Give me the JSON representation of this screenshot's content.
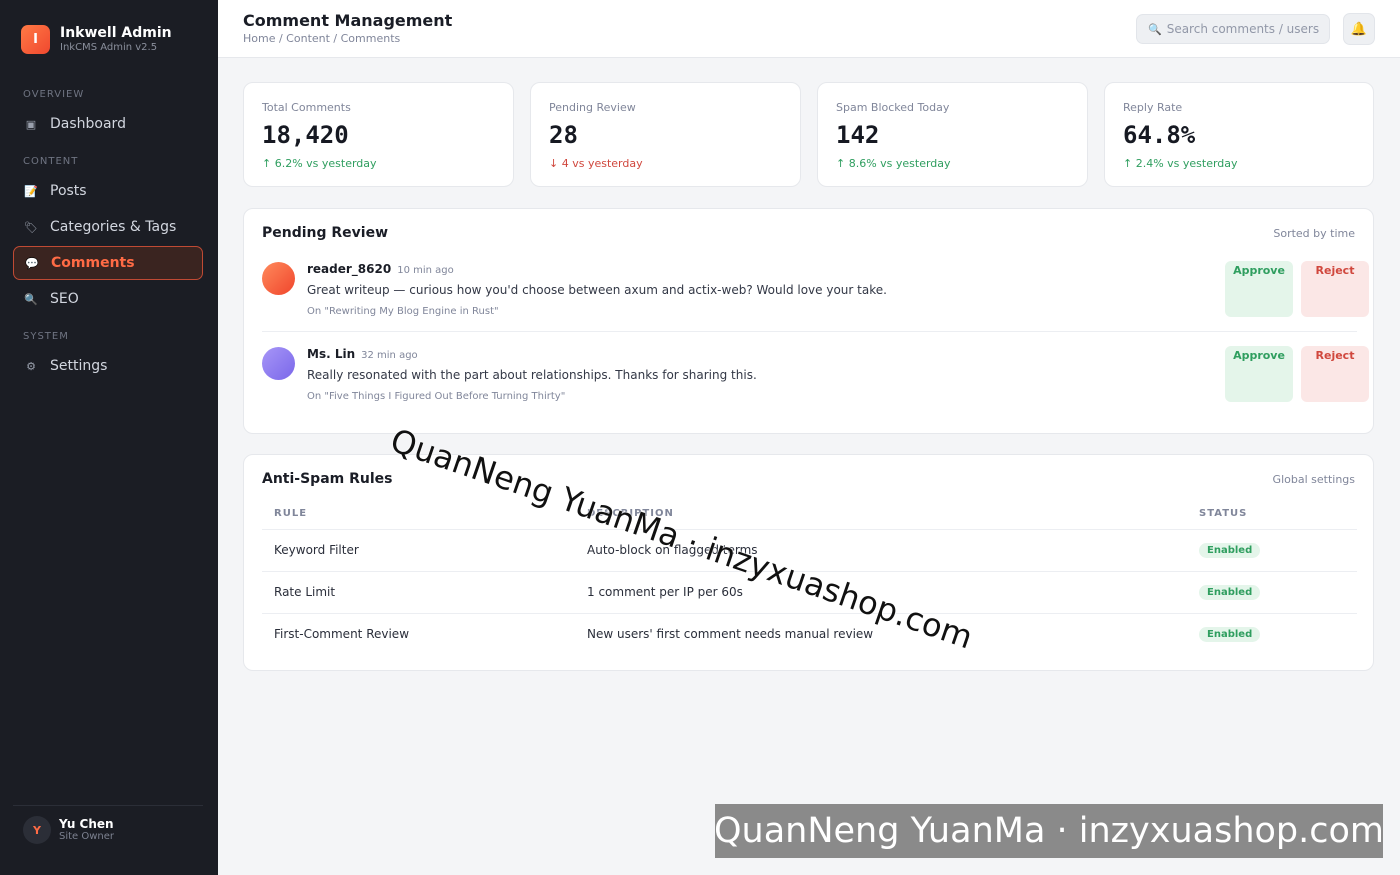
{
  "brand": {
    "logo_letter": "I",
    "name": "Inkwell Admin",
    "subtitle": "InkCMS Admin v2.5"
  },
  "sidebar": {
    "sections": [
      {
        "label": "OVERVIEW"
      },
      {
        "label": "CONTENT"
      },
      {
        "label": "SYSTEM"
      }
    ],
    "items": [
      {
        "label": "Dashboard",
        "icon": "dashboard-icon",
        "glyph": "▣"
      },
      {
        "label": "Posts",
        "icon": "memo-icon",
        "glyph": "📝"
      },
      {
        "label": "Categories & Tags",
        "icon": "tag-icon",
        "glyph": "🏷"
      },
      {
        "label": "Comments",
        "icon": "speech-bubble-icon",
        "glyph": "💬",
        "active": true
      },
      {
        "label": "SEO",
        "icon": "magnifier-icon",
        "glyph": "🔍"
      },
      {
        "label": "Settings",
        "icon": "gear-icon",
        "glyph": "⚙"
      }
    ],
    "user": {
      "initial": "Y",
      "name": "Yu Chen",
      "role": "Site Owner"
    }
  },
  "header": {
    "title": "Comment Management",
    "breadcrumb": "Home / Content / Comments",
    "search_placeholder": "Search comments / users",
    "search_icon": "🔍",
    "bell_icon": "🔔"
  },
  "stats": [
    {
      "label": "Total Comments",
      "value": "18,420",
      "delta": "↑ 6.2% vs yesterday",
      "trend": "up"
    },
    {
      "label": "Pending Review",
      "value": "28",
      "delta": "↓ 4 vs yesterday",
      "trend": "down"
    },
    {
      "label": "Spam Blocked Today",
      "value": "142",
      "delta": "↑ 8.6% vs yesterday",
      "trend": "up"
    },
    {
      "label": "Reply Rate",
      "value": "64.8%",
      "delta": "↑ 2.4% vs yesterday",
      "trend": "up"
    }
  ],
  "pending": {
    "title": "Pending Review",
    "meta": "Sorted by time",
    "approve_label": "Approve",
    "reject_label": "Reject",
    "comments": [
      {
        "author": "reader_8620",
        "time": "10 min ago",
        "text": "Great writeup — curious how you'd choose between axum and actix-web? Would love your take.",
        "post": "On \"Rewriting My Blog Engine in Rust\"",
        "avatar_color": "#f0583a"
      },
      {
        "author": "Ms. Lin",
        "time": "32 min ago",
        "text": "Really resonated with the part about relationships. Thanks for sharing this.",
        "post": "On \"Five Things I Figured Out Before Turning Thirty\"",
        "avatar_color": "#8b7cf0"
      }
    ]
  },
  "antispam": {
    "title": "Anti-Spam Rules",
    "meta": "Global settings",
    "columns": [
      "RULE",
      "DESCRIPTION",
      "STATUS"
    ],
    "rows": [
      {
        "rule": "Keyword Filter",
        "description": "Auto-block on flagged terms",
        "status": "Enabled"
      },
      {
        "rule": "Rate Limit",
        "description": "1 comment per IP per 60s",
        "status": "Enabled"
      },
      {
        "rule": "First-Comment Review",
        "description": "New users' first comment needs manual review",
        "status": "Enabled"
      }
    ]
  },
  "watermark": {
    "text": "QuanNeng YuanMa · inzyxuashop.com"
  },
  "colors": {
    "accent": "#ff6b45",
    "success": "#2f9e5f",
    "danger": "#d0473d",
    "sidebar_bg": "#1b1d24"
  }
}
